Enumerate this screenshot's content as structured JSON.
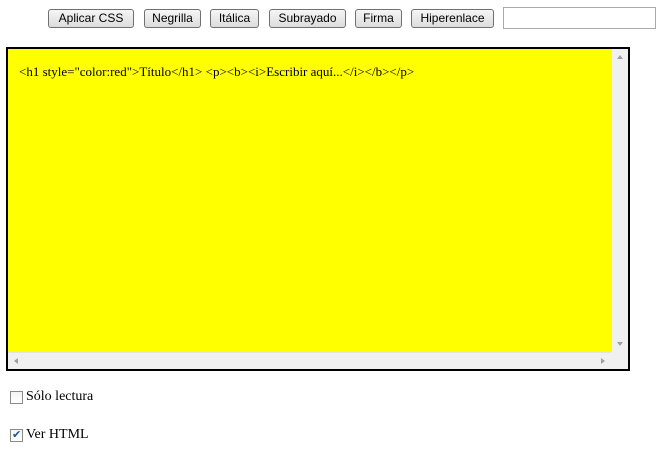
{
  "toolbar": {
    "apply_css_label": "Aplicar CSS",
    "bold_label": "Negrilla",
    "italic_label": "Itálica",
    "underline_label": "Subrayado",
    "signature_label": "Firma",
    "hyperlink_label": "Hiperenlace",
    "link_input_value": ""
  },
  "editor": {
    "html_source": "<h1 style=\"color:red\">Título</h1> <p><b><i>Escribir aquí...</i></b></p>",
    "background_color": "#ffff00"
  },
  "options": {
    "readonly_label": "Sólo lectura",
    "readonly_checked": false,
    "show_html_label": "Ver HTML",
    "show_html_checked": true
  }
}
